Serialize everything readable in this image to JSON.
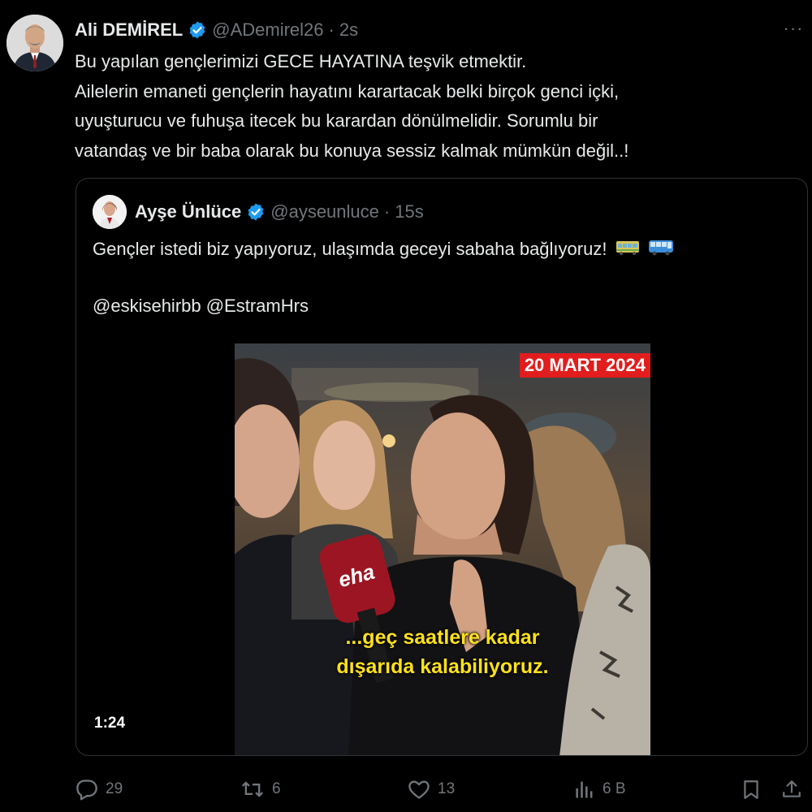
{
  "author": {
    "name": "Ali DEMİREL",
    "handle": "@ADemirel26",
    "separator": "·",
    "time": "2s",
    "avatar_icon": "avatar-man-suit"
  },
  "tweet_lines": [
    "Bu yapılan gençlerimizi GECE HAYATINA teşvik etmektir.",
    "Ailelerin emaneti gençlerin hayatını karartacak belki birçok genci içki,",
    "uyuşturucu ve fuhuşa itecek bu karardan dönülmelidir. Sorumlu bir",
    "vatandaş ve bir baba olarak bu konuya sessiz kalmak mümkün değil..!"
  ],
  "more_label": "···",
  "quote": {
    "name": "Ayşe Ünlüce",
    "handle": "@ayseunluce",
    "separator": "·",
    "time": "15s",
    "text": "Gençler istedi biz yapıyoruz, ulaşımda geceyi sabaha bağlıyoruz!",
    "emojis": [
      "tram-icon",
      "bus-icon"
    ],
    "mentions": "@eskisehirbb @EstramHrs",
    "video": {
      "date_badge": "20 MART 2024",
      "mic_logo": "eha",
      "caption_line1": "...geç saatlere kadar",
      "caption_line2": "dışarıda kalabiliyoruz.",
      "duration": "1:24"
    }
  },
  "actions": {
    "replies": "29",
    "reposts": "6",
    "likes": "13",
    "views": "6 B"
  },
  "colors": {
    "background": "#000000",
    "text": "#e7e9ea",
    "muted": "#71767b",
    "verified": "#1d9bf0",
    "border": "#2f3336"
  }
}
